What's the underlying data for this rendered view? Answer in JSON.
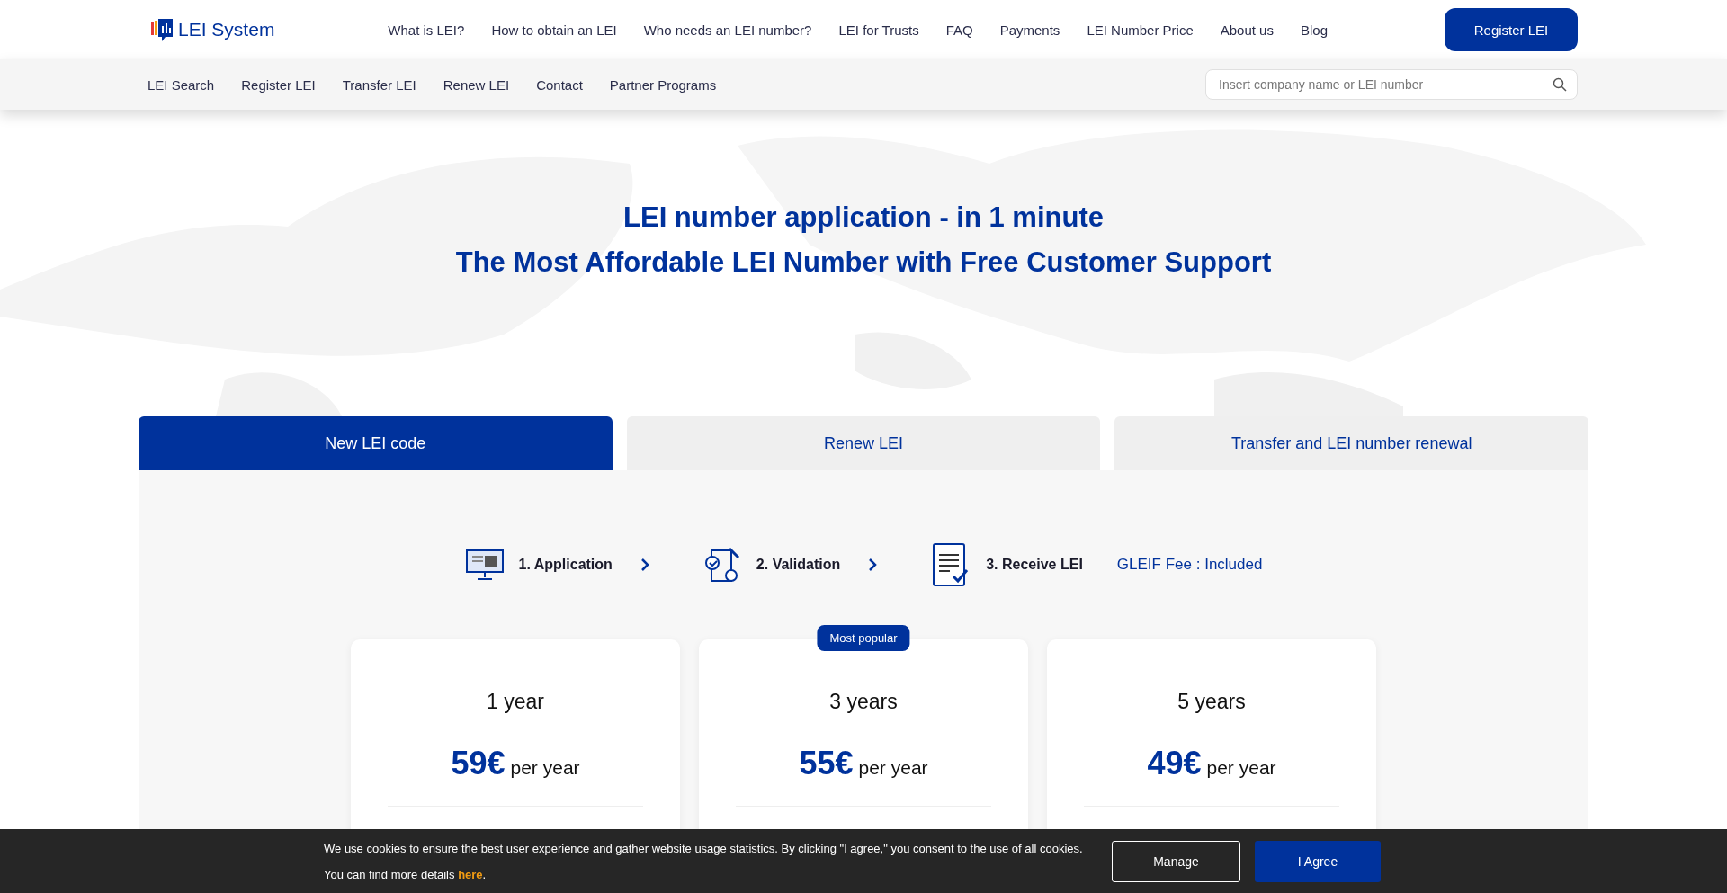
{
  "header": {
    "logo": "LEI System",
    "nav": [
      "What is LEI?",
      "How to obtain an LEI",
      "Who needs an LEI number?",
      "LEI for Trusts",
      "FAQ",
      "Payments",
      "LEI Number Price",
      "About us",
      "Blog"
    ],
    "cta": "Register LEI"
  },
  "subnav": {
    "items": [
      "LEI Search",
      "Register LEI",
      "Transfer LEI",
      "Renew LEI",
      "Contact",
      "Partner Programs"
    ],
    "search": {
      "placeholder": "Insert company name or LEI number"
    }
  },
  "hero": {
    "title": "LEI number application - in 1 minute",
    "subtitle": "The Most Affordable LEI Number with Free Customer Support"
  },
  "tabs": [
    {
      "label": "New LEI code",
      "selected": true
    },
    {
      "label": "Renew LEI",
      "selected": false
    },
    {
      "label": "Transfer and LEI number renewal",
      "selected": false
    }
  ],
  "steps": [
    {
      "kind": "application",
      "label": "1. Application"
    },
    {
      "kind": "validation",
      "label": "2. Validation"
    },
    {
      "kind": "receive",
      "label": "3. Receive LEI"
    }
  ],
  "fee": "GLEIF Fee : Included",
  "plans": [
    {
      "term": "1 year",
      "price": "59€",
      "unit": "per year"
    },
    {
      "badge": "Most popular",
      "term": "3 years",
      "price": "55€",
      "unit": "per year"
    },
    {
      "term": "5 years",
      "price": "49€",
      "unit": "per year"
    }
  ],
  "cookie": {
    "text": "We use cookies to ensure the best user experience and gather website usage statistics. By clicking \"I agree,\" you consent to the use of all cookies. You can find more details",
    "link": "here",
    "end": ".",
    "buttons": [
      {
        "kind": "outline",
        "label": "Manage"
      },
      {
        "kind": "primary",
        "label": "I Agree"
      }
    ]
  }
}
